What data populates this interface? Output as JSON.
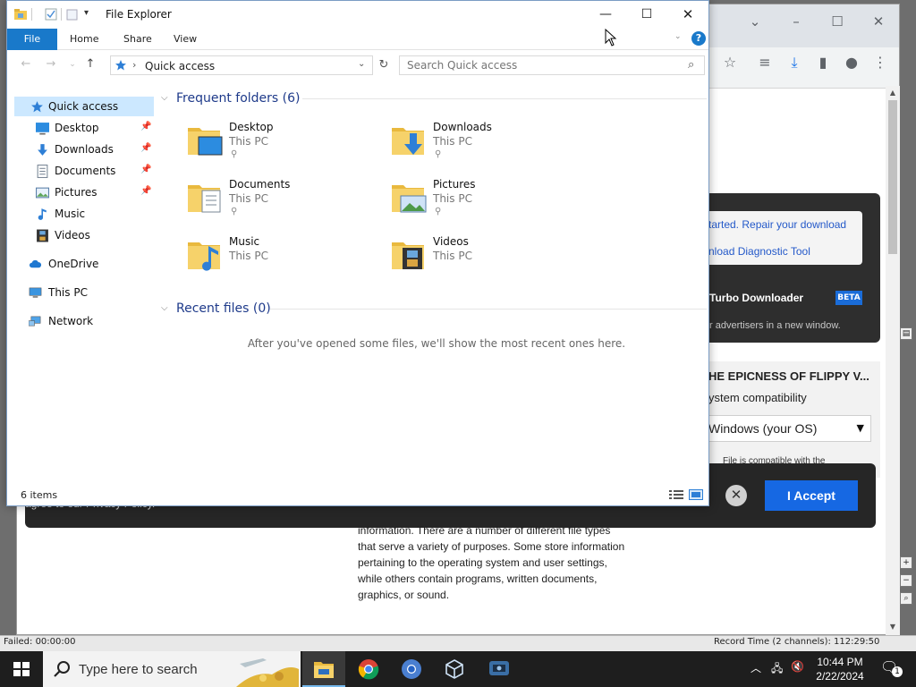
{
  "browser": {
    "download_links": [
      "tarted. Repair your download",
      "nload Diagnostic Tool"
    ],
    "turbo_label": "Turbo Downloader",
    "beta_badge": "BETA",
    "advertisers_note": "r advertisers in a new window.",
    "app_title": "HE EPICNESS OF FLIPPY V...",
    "compat_label": "ystem compatibility",
    "os_select_value": "Windows (your OS)",
    "compat_note": "File is compatible with the",
    "cookie_text": "agree to our Privacy Policy.",
    "accept_label": "I Accept",
    "article_lines": [
      "information. There are a number of different file types",
      "that serve a variety of purposes. Some store information",
      "pertaining to the operating system and user settings,",
      "while others contain programs, written documents,",
      "graphics, or sound."
    ]
  },
  "recorder": {
    "status_left": "Failed: 00:00:00",
    "status_right": "Record Time (2 channels): 112:29:50"
  },
  "explorer": {
    "title": "File Explorer",
    "ribbon_tabs": [
      "File",
      "Home",
      "Share",
      "View"
    ],
    "address": "Quick access",
    "search_placeholder": "Search Quick access",
    "nav_items": [
      {
        "label": "Quick access",
        "icon": "star-icon"
      },
      {
        "label": "Desktop",
        "icon": "desktop-icon"
      },
      {
        "label": "Downloads",
        "icon": "download-arrow-icon"
      },
      {
        "label": "Documents",
        "icon": "document-icon"
      },
      {
        "label": "Pictures",
        "icon": "picture-icon"
      },
      {
        "label": "Music",
        "icon": "music-note-icon"
      },
      {
        "label": "Videos",
        "icon": "film-icon"
      },
      {
        "label": "OneDrive",
        "icon": "cloud-icon"
      },
      {
        "label": "This PC",
        "icon": "monitor-icon"
      },
      {
        "label": "Network",
        "icon": "network-icon"
      }
    ],
    "frequent_header": "Frequent folders (6)",
    "folders": [
      {
        "name": "Desktop",
        "location": "This PC"
      },
      {
        "name": "Downloads",
        "location": "This PC"
      },
      {
        "name": "Documents",
        "location": "This PC"
      },
      {
        "name": "Pictures",
        "location": "This PC"
      },
      {
        "name": "Music",
        "location": "This PC"
      },
      {
        "name": "Videos",
        "location": "This PC"
      }
    ],
    "recent_header": "Recent files (0)",
    "recent_empty": "After you've opened some files, we'll show the most recent ones here.",
    "item_count": "6 items"
  },
  "taskbar": {
    "search_placeholder": "Type here to search",
    "time": "10:44 PM",
    "date": "2/22/2024",
    "notification_count": "1"
  },
  "colors": {
    "accent": "#1979ca",
    "accept_button": "#1668e3",
    "folder_yellow": "#f4c84f",
    "taskbar": "#1e1e1e"
  }
}
